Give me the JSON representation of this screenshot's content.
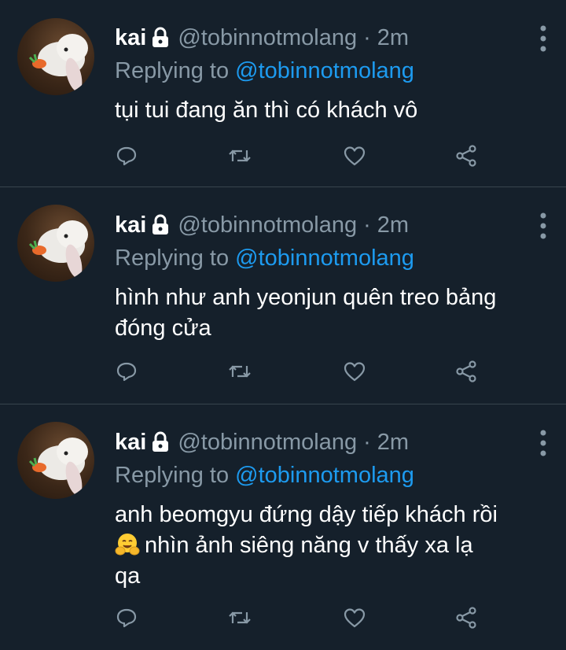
{
  "tweets": [
    {
      "name": "kai",
      "handle": "@tobinnotmolang",
      "separator": "·",
      "time": "2m",
      "reply_prefix": "Replying to ",
      "reply_to": "@tobinnotmolang",
      "text_line1": "tụi tui đang ăn thì có khách vô",
      "text_line2": "",
      "text_line3": ""
    },
    {
      "name": "kai",
      "handle": "@tobinnotmolang",
      "separator": "·",
      "time": "2m",
      "reply_prefix": "Replying to ",
      "reply_to": "@tobinnotmolang",
      "text_line1": "hình như anh yeonjun quên treo bảng",
      "text_line2": "đóng cửa",
      "text_line3": ""
    },
    {
      "name": "kai",
      "handle": "@tobinnotmolang",
      "separator": "·",
      "time": "2m",
      "reply_prefix": "Replying to ",
      "reply_to": "@tobinnotmolang",
      "text_line1": "anh beomgyu đứng dậy tiếp khách rồi",
      "text_line2": "nhìn ảnh siêng năng v thấy xa lạ",
      "text_line3": "qa",
      "emoji": "hugging-face-emoji"
    }
  ],
  "icons": {
    "lock": "lock-icon",
    "more": "more-vertical-icon",
    "reply": "reply-icon",
    "retweet": "retweet-icon",
    "like": "heart-icon",
    "share": "share-icon"
  },
  "colors": {
    "background": "#15202b",
    "secondary_text": "#8899a6",
    "mention": "#1d9bf0",
    "divider": "#38444d"
  }
}
